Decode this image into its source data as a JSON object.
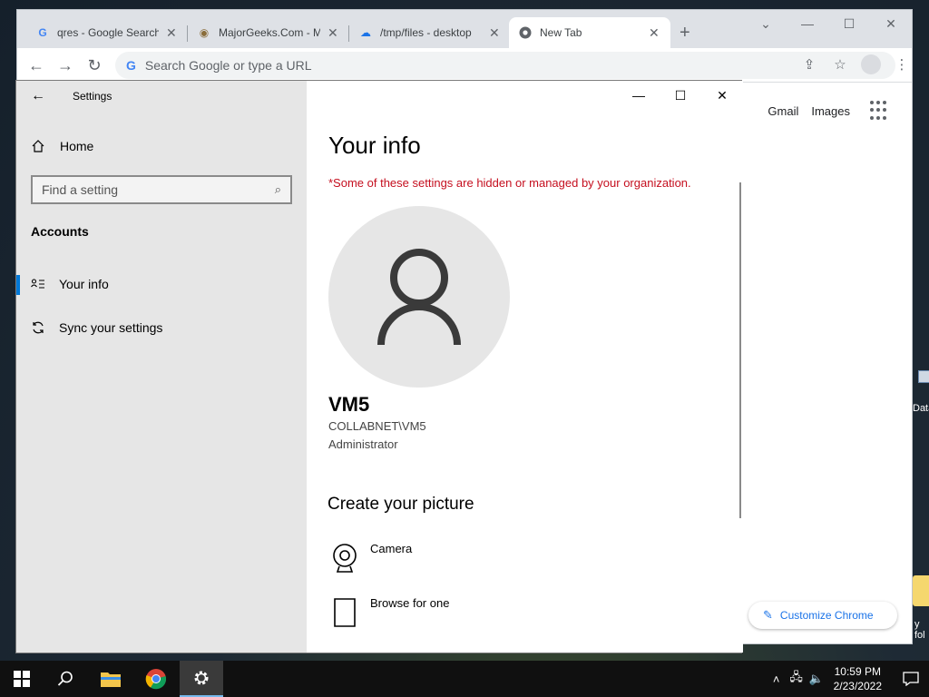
{
  "chrome": {
    "tabs": [
      {
        "favicon": "G",
        "title": "qres - Google Search"
      },
      {
        "favicon": "mg",
        "title": "MajorGeeks.Com - M"
      },
      {
        "favicon": "cloud",
        "title": "/tmp/files - desktop"
      },
      {
        "favicon": "chrome",
        "title": "New Tab"
      }
    ],
    "omnibox_placeholder": "Search Google or type a URL",
    "links": {
      "gmail": "Gmail",
      "images": "Images"
    },
    "customize_label": "Customize Chrome"
  },
  "settings": {
    "title": "Settings",
    "home_label": "Home",
    "search_placeholder": "Find a setting",
    "section": "Accounts",
    "nav": [
      {
        "label": "Your info",
        "selected": true
      },
      {
        "label": "Sync your settings",
        "selected": false
      }
    ],
    "page_title": "Your info",
    "warning": "*Some of these settings are hidden or managed by your organization.",
    "user": {
      "name": "VM5",
      "domain": "COLLABNET\\VM5",
      "role": "Administrator"
    },
    "create_title": "Create your picture",
    "options": [
      {
        "icon": "camera-icon",
        "label": "Camera"
      },
      {
        "icon": "file-icon",
        "label": "Browse for one"
      }
    ]
  },
  "desktop": {
    "partial_label": "Data",
    "partial_label2": "y fol"
  },
  "taskbar": {
    "time": "10:59 PM",
    "date": "2/23/2022"
  },
  "colors": {
    "accent": "#0078d7",
    "warning": "#c50f1f",
    "chrome_blue": "#1a73e8"
  }
}
